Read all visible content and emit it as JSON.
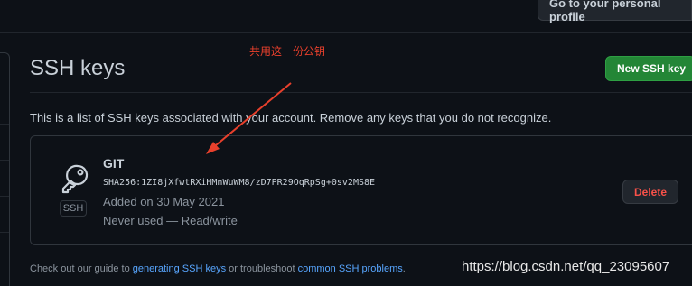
{
  "header": {
    "profile_button": "Go to your personal profile"
  },
  "page": {
    "title": "SSH keys",
    "new_button": "New SSH key",
    "intro": "This is a list of SSH keys associated with your account. Remove any keys that you do not recognize."
  },
  "key": {
    "name": "GIT",
    "fingerprint": "SHA256:1ZI8jXfwtRXiHMnWuWM8/zD7PR29OqRpSg+0sv2MS8E",
    "added": "Added on 30 May 2021",
    "usage": "Never used — Read/write",
    "badge": "SSH",
    "icon": "key-icon",
    "delete_button": "Delete"
  },
  "footer": {
    "prefix": "Check out our guide to",
    "link1": "generating SSH keys",
    "middle": "or troubleshoot",
    "link2": "common SSH problems",
    "suffix": "."
  },
  "annotation": {
    "text": "共用这一份公钥",
    "color": "#e8402c"
  },
  "watermark": "https://blog.csdn.net/qq_23095607",
  "colors": {
    "background": "#0d1117",
    "primary_button": "#238636",
    "danger_text": "#f85149",
    "link": "#58a6ff"
  }
}
